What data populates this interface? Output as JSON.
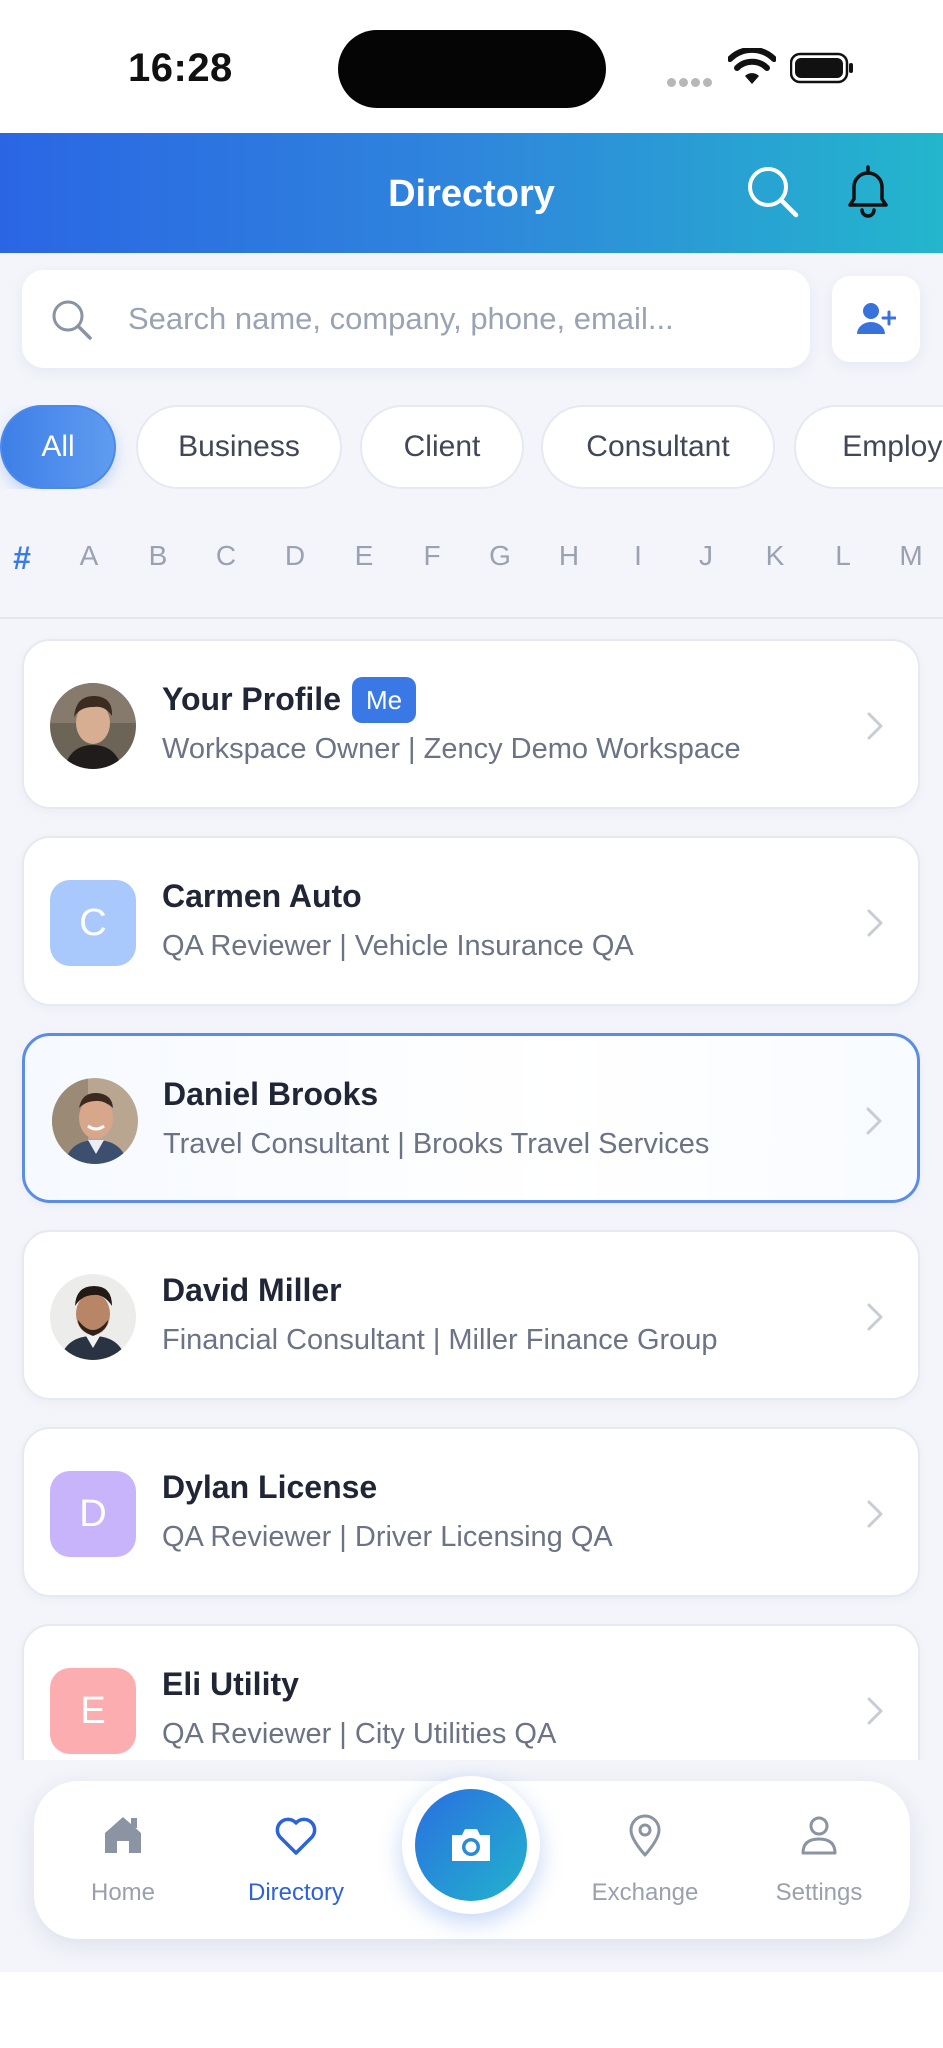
{
  "status_bar": {
    "time": "16:28"
  },
  "header": {
    "title": "Directory"
  },
  "search": {
    "placeholder": "Search name, company, phone, email..."
  },
  "filters": [
    {
      "label": "All",
      "active": true
    },
    {
      "label": "Business",
      "active": false
    },
    {
      "label": "Client",
      "active": false
    },
    {
      "label": "Consultant",
      "active": false
    },
    {
      "label": "Employee",
      "active": false
    }
  ],
  "alphabet": [
    "#",
    "A",
    "B",
    "C",
    "D",
    "E",
    "F",
    "G",
    "H",
    "I",
    "J",
    "K",
    "L",
    "M"
  ],
  "alphabet_active": "#",
  "contacts": [
    {
      "name": "Your Profile",
      "subtitle": "Workspace Owner | Zency Demo Workspace",
      "badge": "Me",
      "avatar": "photo",
      "selected": false
    },
    {
      "name": "Carmen Auto",
      "subtitle": "QA Reviewer | Vehicle Insurance QA",
      "avatar": "letter",
      "initial": "C",
      "color": "#a9c8fb",
      "selected": false
    },
    {
      "name": "Daniel Brooks",
      "subtitle": "Travel Consultant | Brooks Travel Services",
      "avatar": "photo",
      "selected": true
    },
    {
      "name": "David Miller",
      "subtitle": "Financial Consultant | Miller Finance Group",
      "avatar": "photo",
      "selected": false
    },
    {
      "name": "Dylan License",
      "subtitle": "QA Reviewer | Driver Licensing QA",
      "avatar": "letter",
      "initial": "D",
      "color": "#c7b4fb",
      "selected": false
    },
    {
      "name": "Eli Utility",
      "subtitle": "QA Reviewer | City Utilities QA",
      "avatar": "letter",
      "initial": "E",
      "color": "#fcadb0",
      "selected": false
    }
  ],
  "bottom_nav": {
    "home": "Home",
    "directory": "Directory",
    "exchange": "Exchange",
    "settings": "Settings",
    "active": "directory"
  },
  "colors": {
    "accent": "#3b7be5",
    "header_start": "#2a66e4",
    "header_end": "#23b6cc"
  }
}
